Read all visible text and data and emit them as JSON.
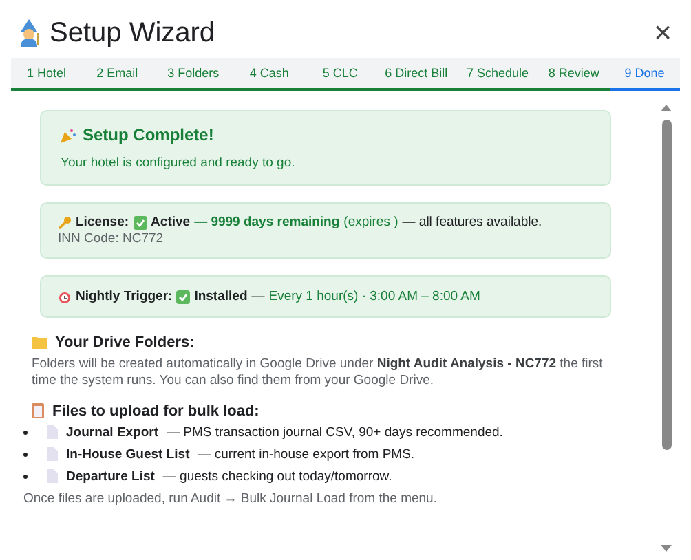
{
  "window": {
    "title": "Setup Wizard",
    "close": "×"
  },
  "steps": [
    {
      "label": "1 Hotel",
      "done": true,
      "selected": false
    },
    {
      "label": "2 Email",
      "done": true,
      "selected": false
    },
    {
      "label": "3 Folders",
      "done": true,
      "selected": false
    },
    {
      "label": "4 Cash",
      "done": true,
      "selected": false
    },
    {
      "label": "5 CLC",
      "done": true,
      "selected": false
    },
    {
      "label": "6 Direct Bill",
      "done": true,
      "selected": false
    },
    {
      "label": "7 Schedule",
      "done": true,
      "selected": false
    },
    {
      "label": "8 Review",
      "done": true,
      "selected": false
    },
    {
      "label": "9 Done",
      "done": false,
      "selected": true
    }
  ],
  "complete": {
    "title": "Setup Complete!",
    "message": "Your hotel is configured and ready to go."
  },
  "license": {
    "label": "License:",
    "status": "Active",
    "remaining": "— 9999 days remaining",
    "expires": "(expires )",
    "note": "— all features available.",
    "inn_code": "INN Code: NC772"
  },
  "trigger": {
    "label": "Nightly Trigger:",
    "status": "Installed",
    "dash": "—",
    "schedule": "Every 1 hour(s) · 3:00 AM – 8:00 AM"
  },
  "folders": {
    "heading": "Your Drive Folders:",
    "text": "Folders will be created automatically in Google Drive under **Night Audit Analysis - NC772** the first time the system runs. You can also find them from your Google Drive."
  },
  "files": {
    "heading": "Files to upload for bulk load:",
    "items": [
      {
        "name": "Journal Export",
        "desc": "— PMS transaction journal CSV, 90+ days recommended."
      },
      {
        "name": "In-House Guest List",
        "desc": "— current in-house export from PMS."
      },
      {
        "name": "Departure List",
        "desc": "— guests checking out today/tomorrow."
      }
    ],
    "footer": "Once files are uploaded, run Audit → Bulk Journal Load from the menu."
  }
}
